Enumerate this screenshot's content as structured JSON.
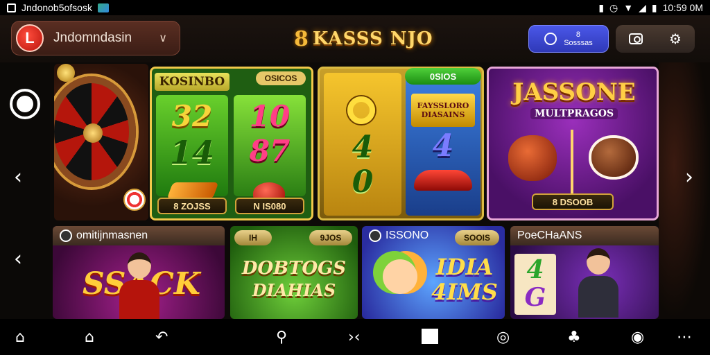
{
  "status_bar": {
    "app_name": "Jndonob5ofsosk",
    "time": "10:59 0M",
    "left_icons": [
      "square-icon",
      "app-thumbnail-icon"
    ],
    "right_icons": [
      "notification-icon",
      "alarm-icon",
      "wifi-icon",
      "signal-icon",
      "battery-icon"
    ]
  },
  "header": {
    "account_name": "Jndomndasin",
    "brand_prefix": "8",
    "brand_name": "KASSS NJO",
    "wallet_line1": "8",
    "wallet_line2": "Sosssas"
  },
  "banners": [
    {
      "name": "roulette-banner"
    },
    {
      "name": "green-slot-banner",
      "title": "KOSINBO",
      "pill": "OSICOS",
      "reel1_top": "32",
      "reel1_mid": "14",
      "reel2_top": "10",
      "reel2_mid": "87",
      "bar1": "8 ZOJSS",
      "bar2": "N IS080"
    },
    {
      "name": "gold-slot-banner",
      "pill": "0SIOS",
      "gold_mid": "4",
      "gold_bot": "0",
      "blue_title": "FAYSSLORO DIASAINS",
      "blue_mid": "4"
    },
    {
      "name": "purple-banner",
      "title": "JASSONE",
      "subtitle": "MULTPRAGOS",
      "bar": "8 DSOOB"
    }
  ],
  "games": [
    {
      "label": "omitijnmasnen",
      "title": "SSACK"
    },
    {
      "pill_left": "IH",
      "pill_right": "9JOS",
      "title_line1": "DOBTOGS",
      "title_line2": "DIAHIAS"
    },
    {
      "label": "ISSONO",
      "pill": "SOOIS",
      "title_line1": "IDIA",
      "title_line2": "4IMS"
    },
    {
      "label": "PoeCHaANS",
      "reel1": "4",
      "reel2": "G"
    }
  ],
  "nav_icons": [
    "home-icon",
    "store-icon",
    "back-icon",
    "search-icon",
    "collapse-icon",
    "inbox-icon",
    "chat-icon",
    "rewards-icon",
    "profile-icon",
    "more-icon"
  ],
  "colors": {
    "accent_gold": "#ffd76a",
    "wallet_blue": "#4a57e8",
    "background": "#0d0a08"
  }
}
